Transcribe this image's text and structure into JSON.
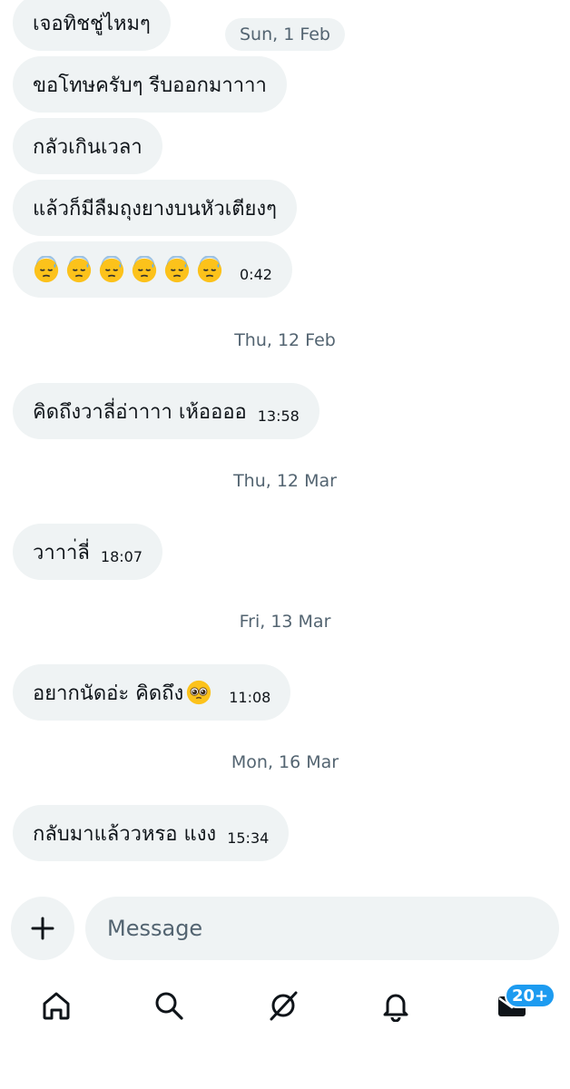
{
  "messages": [
    {
      "text": "เจอทิชชู่ไหมๆ",
      "time": ""
    },
    {
      "text": "ขอโทษครับๆ รีบออกมาาาา",
      "time": ""
    },
    {
      "text": "กลัวเกินเวลา",
      "time": ""
    },
    {
      "text": "แล้วก็มีลืมถุงยางบนหัวเตียงๆ",
      "time": ""
    },
    {
      "text": "",
      "time": "0:42",
      "emoji_count": 6,
      "emoji_name": "downcast-face-with-sweat"
    },
    {
      "text": "คิดถึงวาลี่อ่าาาา เห้ออออ",
      "time": "13:58"
    },
    {
      "text": "วาาา่ลี่",
      "time": "18:07"
    },
    {
      "text": "อยากนัดอ่ะ คิดถึง",
      "time": "11:08",
      "emoji_name": "pleading-face"
    },
    {
      "text": "กลับมาแล้ววหรอ แงง",
      "time": "15:34"
    }
  ],
  "dates": {
    "sun_1_feb": "Sun, 1 Feb",
    "thu_12_feb": "Thu, 12 Feb",
    "thu_12_mar": "Thu, 12 Mar",
    "fri_13_mar": "Fri, 13 Mar",
    "mon_16_mar": "Mon, 16 Mar"
  },
  "composer": {
    "placeholder": "Message",
    "add_icon": "plus-icon"
  },
  "nav": {
    "items": [
      "home-icon",
      "search-icon",
      "grok-icon",
      "notifications-icon",
      "messages-icon"
    ],
    "badge": "20+"
  },
  "colors": {
    "bubble": "#eff3f4",
    "muted_text": "#536471",
    "accent": "#1d9bf0",
    "text": "#0f1419"
  }
}
